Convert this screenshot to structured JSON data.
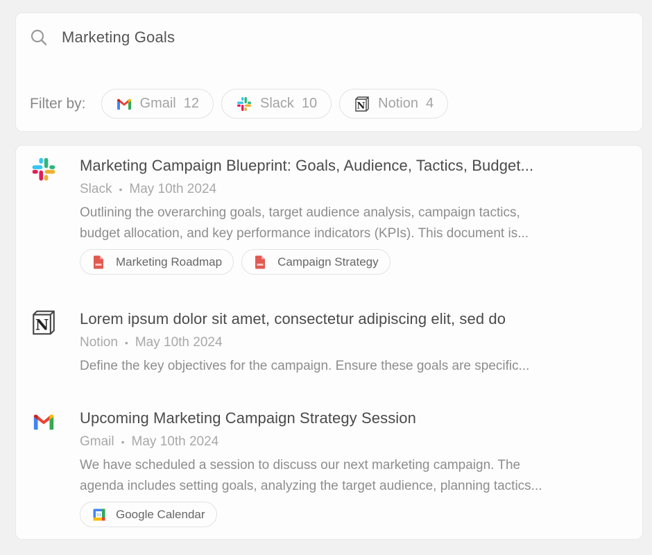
{
  "search": {
    "value": "Marketing Goals",
    "icon": "search-icon"
  },
  "filters": {
    "label": "Filter by:",
    "items": [
      {
        "name": "Gmail",
        "count": "12",
        "icon": "gmail-icon"
      },
      {
        "name": "Slack",
        "count": "10",
        "icon": "slack-icon"
      },
      {
        "name": "Notion",
        "count": "4",
        "icon": "notion-icon"
      }
    ]
  },
  "results": [
    {
      "source": "Slack",
      "icon": "slack-icon",
      "title": "Marketing Campaign Blueprint: Goals, Audience, Tactics, Budget...",
      "date": "May 10th 2024",
      "snippet_lines": [
        "Outlining the overarching goals, target audience analysis, campaign tactics,",
        "budget allocation, and key performance indicators (KPIs). This document is..."
      ],
      "attachments": [
        {
          "label": "Marketing Roadmap",
          "icon": "pdf-icon"
        },
        {
          "label": "Campaign Strategy",
          "icon": "pdf-icon"
        }
      ]
    },
    {
      "source": "Notion",
      "icon": "notion-icon",
      "title": "Lorem ipsum dolor sit amet, consectetur adipiscing elit, sed do",
      "date": "May 10th 2024",
      "snippet_lines": [
        "Define the key objectives for the campaign. Ensure these goals are specific..."
      ],
      "attachments": []
    },
    {
      "source": "Gmail",
      "icon": "gmail-icon",
      "title": "Upcoming Marketing Campaign Strategy Session",
      "date": "May 10th 2024",
      "snippet_lines": [
        "We have scheduled a session to discuss our next marketing campaign. The",
        "agenda includes setting goals, analyzing the target audience, planning tactics..."
      ],
      "attachments": [
        {
          "label": "Google Calendar",
          "icon": "google-calendar-icon"
        }
      ]
    }
  ],
  "meta_separator": "•",
  "colors": {
    "background": "#f1f1f1",
    "card": "#fdfdfd",
    "title_text": "#4a4a4a",
    "muted_text": "#a8a8a8",
    "pdf_red": "#e05a52"
  }
}
